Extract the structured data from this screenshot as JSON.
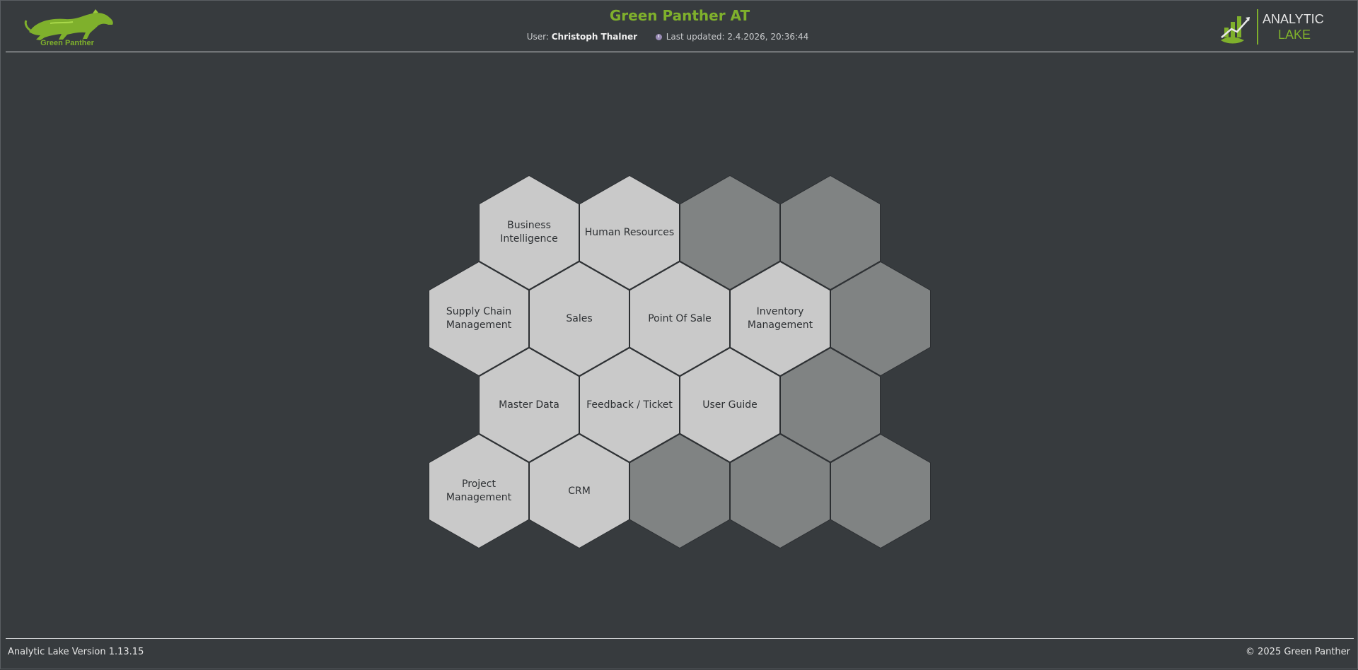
{
  "header": {
    "title": "Green Panther AT",
    "user_label": "User:",
    "user_name": "Christoph Thalner",
    "updated_label": "Last updated: 2.4.2026, 20:36:44",
    "logo_left_text": "Green Panther",
    "logo_right_line1": "ANALYTIC",
    "logo_right_line2": "LAKE"
  },
  "modules": [
    {
      "label": "Business Intelligence",
      "active": true
    },
    {
      "label": "Human Resources",
      "active": true
    },
    {
      "label": "",
      "active": false
    },
    {
      "label": "",
      "active": false
    },
    {
      "label": "Supply Chain Management",
      "active": true
    },
    {
      "label": "Sales",
      "active": true
    },
    {
      "label": "Point Of Sale",
      "active": true
    },
    {
      "label": "Inventory Management",
      "active": true
    },
    {
      "label": "",
      "active": false
    },
    {
      "label": "Master Data",
      "active": true
    },
    {
      "label": "Feedback / Ticket",
      "active": true
    },
    {
      "label": "User Guide",
      "active": true
    },
    {
      "label": "",
      "active": false
    },
    {
      "label": "Project Management",
      "active": true
    },
    {
      "label": "CRM",
      "active": true
    },
    {
      "label": "",
      "active": false
    },
    {
      "label": "",
      "active": false
    },
    {
      "label": "",
      "active": false
    }
  ],
  "footer": {
    "version": "Analytic Lake Version 1.13.15",
    "copyright": "© 2025 Green Panther"
  },
  "colors": {
    "brand_green": "#7fb02c",
    "background": "#373b3e",
    "tile_active": "#c9c9c9",
    "tile_inactive": "#808383"
  }
}
